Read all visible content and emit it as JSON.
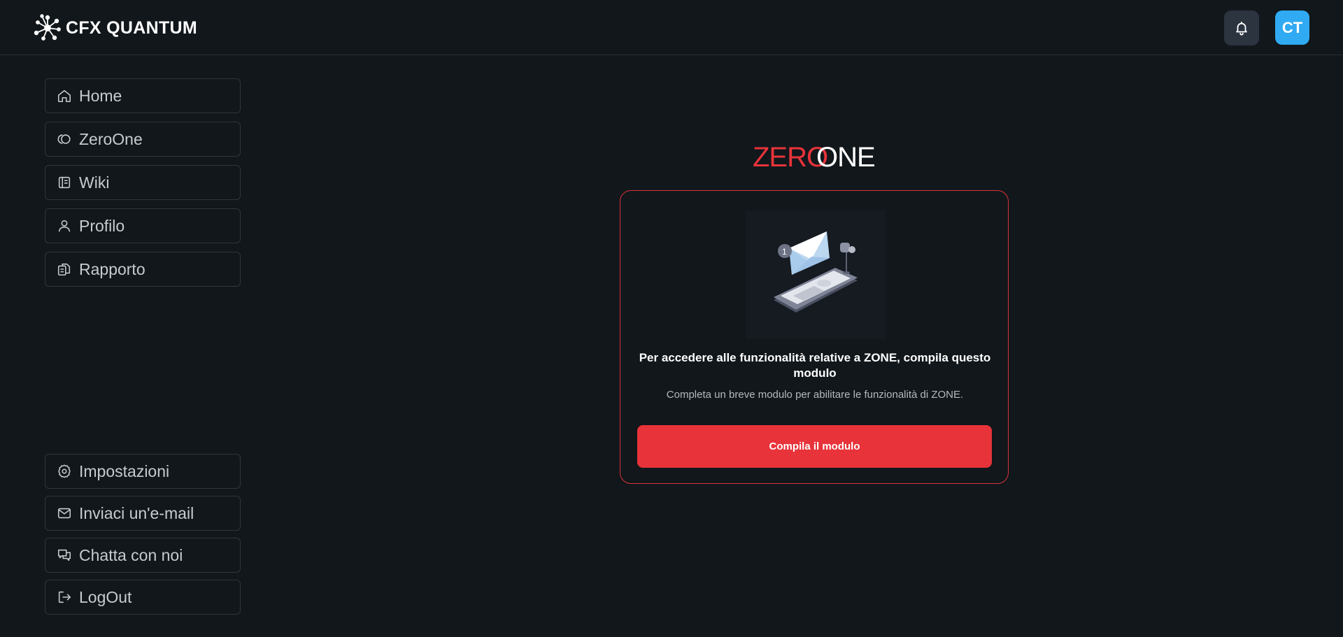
{
  "header": {
    "brand_name": "CFX QUANTUM",
    "avatar_initials": "CT",
    "notification_icon": "bell-icon",
    "accent_avatar": "#30aaf2"
  },
  "sidebar": {
    "top_items": [
      {
        "label": "Home",
        "icon": "home-icon"
      },
      {
        "label": "ZeroOne",
        "icon": "zeroone-icon"
      },
      {
        "label": "Wiki",
        "icon": "book-icon"
      },
      {
        "label": "Profilo",
        "icon": "user-icon"
      },
      {
        "label": "Rapporto",
        "icon": "report-icon"
      }
    ],
    "bottom_items": [
      {
        "label": "Impostazioni",
        "icon": "gear-icon"
      },
      {
        "label": "Inviaci un'e-mail",
        "icon": "mail-icon"
      },
      {
        "label": "Chatta con noi",
        "icon": "chat-icon"
      },
      {
        "label": "LogOut",
        "icon": "logout-icon"
      }
    ]
  },
  "main": {
    "logo_part1": "ZERO",
    "logo_part2": "ONE",
    "card": {
      "title": "Per accedere alle funzionalità relative a ZONE, compila questo modulo",
      "subtitle": "Completa un breve modulo per abilitare le funzionalità di ZONE.",
      "button_label": "Compila il modulo",
      "illustration_badge": "1"
    },
    "colors": {
      "accent_red": "#e8333a",
      "background": "#11171b"
    }
  }
}
